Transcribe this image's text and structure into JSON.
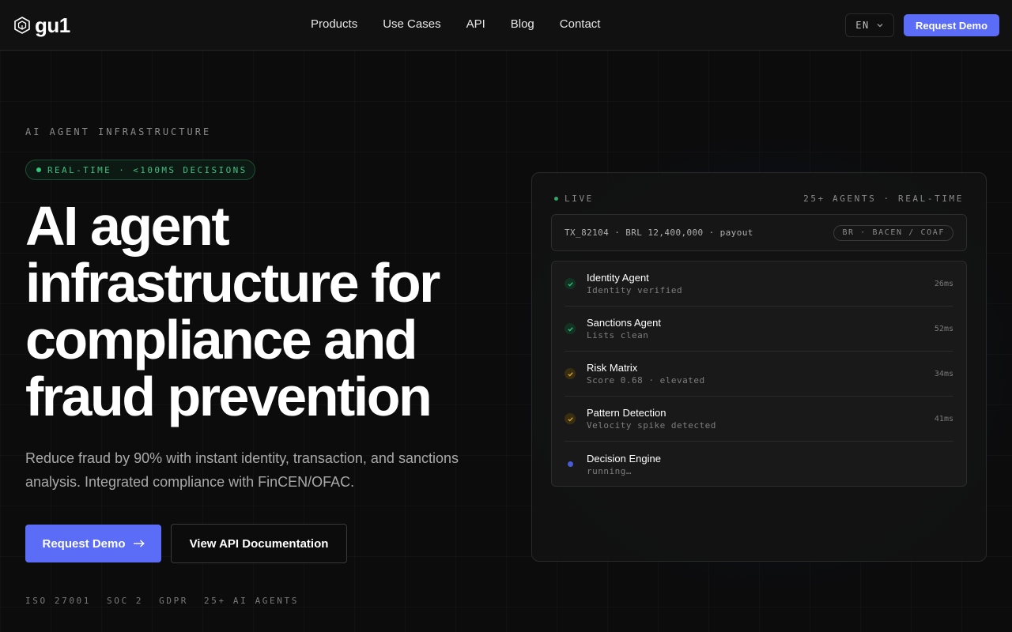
{
  "header": {
    "logo_text": "gu1",
    "nav": [
      "Products",
      "Use Cases",
      "API",
      "Blog",
      "Contact"
    ],
    "lang": "EN",
    "cta": "Request Demo"
  },
  "hero": {
    "eyebrow": "AI AGENT INFRASTRUCTURE",
    "pill": "REAL-TIME · <100MS DECISIONS",
    "headline": "AI agent infrastructure for compliance and fraud prevention",
    "subtext": "Reduce fraud by 90% with instant identity, transaction, and sanctions analysis. Integrated compliance with FinCEN/OFAC.",
    "primary_cta": "Request Demo",
    "secondary_cta": "View API Documentation",
    "badges": [
      "ISO 27001",
      "SOC 2",
      "GDPR",
      "25+ AI AGENTS"
    ]
  },
  "panel": {
    "live_label": "LIVE",
    "meta": "25+ AGENTS · REAL-TIME",
    "transaction": "TX_82104 · BRL 12,400,000 · payout",
    "region_tag": "BR · BACEN / COAF",
    "agents": [
      {
        "name": "Identity Agent",
        "desc": "Identity verified",
        "time": "26ms",
        "status": "ok"
      },
      {
        "name": "Sanctions Agent",
        "desc": "Lists clean",
        "time": "52ms",
        "status": "ok"
      },
      {
        "name": "Risk Matrix",
        "desc": "Score 0.68 · elevated",
        "time": "34ms",
        "status": "warn"
      },
      {
        "name": "Pattern Detection",
        "desc": "Velocity spike detected",
        "time": "41ms",
        "status": "warn"
      },
      {
        "name": "Decision Engine",
        "desc": "running…",
        "time": "",
        "status": "running"
      }
    ]
  },
  "colors": {
    "accent": "#5b6cf7",
    "ok": "#34c77b",
    "warn": "#d9a93a",
    "running": "#4a5bd8",
    "background": "#0c0c0c"
  }
}
